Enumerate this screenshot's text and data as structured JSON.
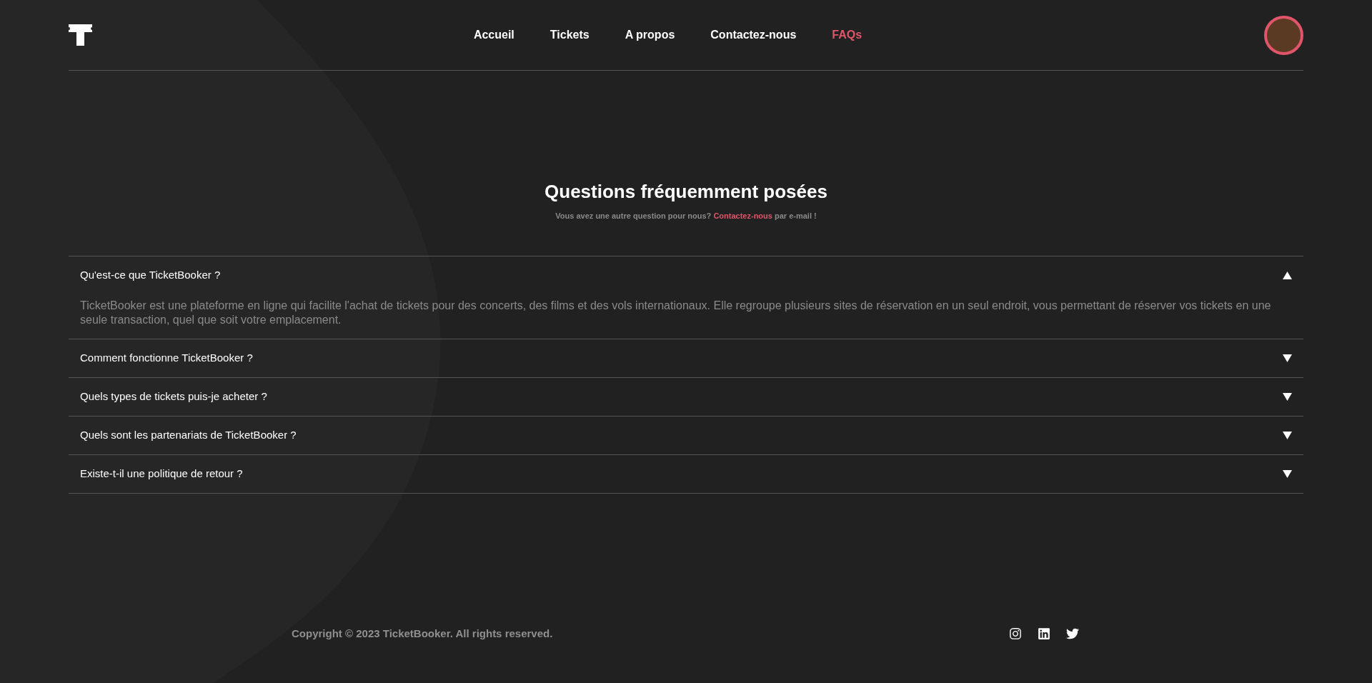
{
  "nav": [
    {
      "label": "Accueil",
      "selected": false
    },
    {
      "label": "Tickets",
      "selected": false
    },
    {
      "label": "A propos",
      "selected": false
    },
    {
      "label": "Contactez-nous",
      "selected": false
    },
    {
      "label": "FAQs",
      "selected": true
    }
  ],
  "heading": "Questions fréquemment posées",
  "subheading": {
    "before": "Vous avez une autre question pour nous?",
    "link": "Contactez-nous",
    "after": "par e-mail !"
  },
  "faqs": [
    {
      "question": "Qu'est-ce que TicketBooker ?",
      "expanded": true,
      "answer": "TicketBooker est une plateforme en ligne qui facilite l'achat de tickets pour des concerts, des films et des vols internationaux. Elle regroupe plusieurs sites de réservation en un seul endroit, vous permettant de réserver vos tickets en une seule transaction, quel que soit votre emplacement."
    },
    {
      "question": "Comment fonctionne TicketBooker ?",
      "expanded": false
    },
    {
      "question": "Quels types de tickets puis-je acheter ?",
      "expanded": false
    },
    {
      "question": "Quels sont les partenariats de TicketBooker ?",
      "expanded": false
    },
    {
      "question": "Existe-t-il une politique de retour ?",
      "expanded": false
    }
  ],
  "footer": {
    "copyright": "Copyright © 2023 TicketBooker. All rights reserved."
  }
}
